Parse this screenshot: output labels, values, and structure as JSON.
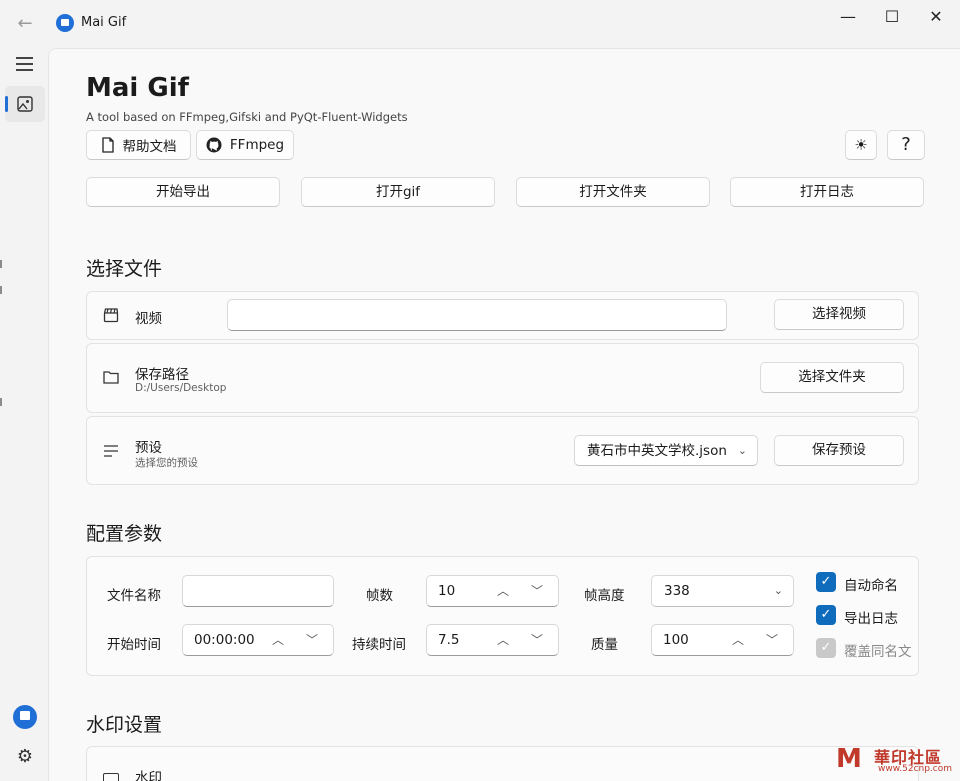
{
  "titlebar": {
    "title": "Mai Gif",
    "back_icon": "←"
  },
  "window_controls": {
    "minimize": "—",
    "maximize": "☐",
    "close": "✕"
  },
  "header": {
    "title": "Mai Gif",
    "subtitle": "A tool based on FFmpeg,Gifski and PyQt-Fluent-Widgets",
    "help_doc": "帮助文档",
    "ffmpeg": "FFmpeg",
    "theme_icon": "☀",
    "help_icon": "?"
  },
  "actions": {
    "start_export": "开始导出",
    "open_gif": "打开gif",
    "open_folder": "打开文件夹",
    "open_log": "打开日志"
  },
  "select_files": {
    "title": "选择文件",
    "video": {
      "label": "视频",
      "value": "",
      "button": "选择视频"
    },
    "save_path": {
      "label": "保存路径",
      "path": "D:/Users/Desktop",
      "button": "选择文件夹"
    },
    "preset": {
      "label": "预设",
      "hint": "选择您的预设",
      "selected": "黄石市中英文学校.json",
      "button": "保存预设"
    }
  },
  "config": {
    "title": "配置参数",
    "file_name": {
      "label": "文件名称",
      "value": ""
    },
    "fps": {
      "label": "帧数",
      "value": "10"
    },
    "frame_height": {
      "label": "帧高度",
      "value": "338"
    },
    "start_time": {
      "label": "开始时间",
      "value": "00:00:00"
    },
    "duration": {
      "label": "持续时间",
      "value": "7.5"
    },
    "quality": {
      "label": "质量",
      "value": "100"
    },
    "auto_name": {
      "label": "自动命名",
      "checked": true
    },
    "export_log": {
      "label": "导出日志",
      "checked": true
    },
    "overwrite": {
      "label": "覆盖同名文",
      "checked": true,
      "disabled": true
    }
  },
  "watermark": {
    "title": "水印设置",
    "row_label": "水印"
  },
  "site_watermark": {
    "text": "華印社區",
    "url": "www.52cnp.com"
  },
  "icons": {
    "spin_up": "︿",
    "spin_down": "﹀",
    "chevron": "⌄",
    "check": "✓",
    "settings": "⚙"
  },
  "colors": {
    "accent": "#0f6cbd",
    "logo": "#1f6fd6"
  }
}
